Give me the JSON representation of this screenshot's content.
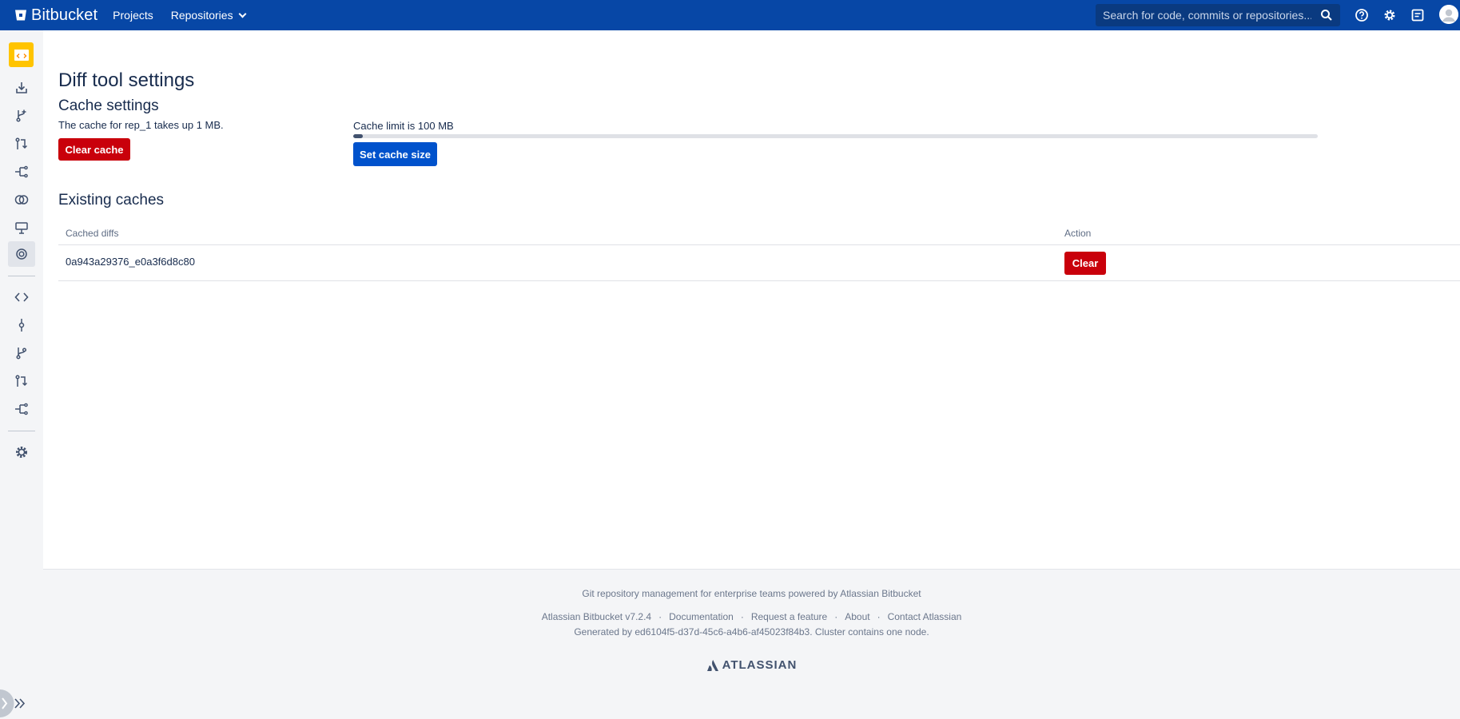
{
  "header": {
    "brand": "Bitbucket",
    "nav": [
      {
        "label": "Projects"
      },
      {
        "label": "Repositories"
      }
    ],
    "search_placeholder": "Search for code, commits or repositories...",
    "icons": [
      "help-icon",
      "gear-icon",
      "inbox-icon",
      "avatar"
    ]
  },
  "sidebar": {
    "items": [
      {
        "icon": "repository-avatar"
      },
      {
        "icon": "clone-icon"
      },
      {
        "icon": "create-branch-icon"
      },
      {
        "icon": "create-pull-request-icon"
      },
      {
        "icon": "fork-icon"
      },
      {
        "icon": "compare-icon"
      },
      {
        "icon": "create-directory-icon"
      },
      {
        "icon": "diff-tool-settings-icon"
      },
      {
        "icon": "source-icon"
      },
      {
        "icon": "commits-icon"
      },
      {
        "icon": "branches-icon"
      },
      {
        "icon": "pull-requests-icon"
      },
      {
        "icon": "forks-icon"
      },
      {
        "icon": "repository-settings-icon"
      },
      {
        "icon": "expand-sidebar-icon"
      }
    ]
  },
  "main": {
    "title": "Diff tool settings",
    "cache_settings": {
      "heading": "Cache settings",
      "description": "The cache for rep_1 takes up 1 MB.",
      "clear_cache_label": "Clear cache",
      "limit_label": "Cache limit is 100 MB",
      "usage_fraction": 0.01,
      "set_size_label": "Set cache size"
    },
    "existing_caches": {
      "heading": "Existing caches",
      "columns": [
        "Cached diffs",
        "Action"
      ],
      "rows": [
        {
          "diff": "0a943a29376_e0a3f6d8c80",
          "action_label": "Clear"
        }
      ]
    }
  },
  "footer": {
    "tagline": "Git repository management for enterprise teams powered by Atlassian Bitbucket",
    "links": [
      "Atlassian Bitbucket v7.2.4",
      "Documentation",
      "Request a feature",
      "About",
      "Contact Atlassian"
    ],
    "separator": "·",
    "generated": "Generated by ed6104f5-d37d-45c6-a4b6-af45023f84b3. Cluster contains one node.",
    "logo_text": "ATLASSIAN"
  },
  "colors": {
    "header_bg": "#0747a6",
    "danger": "#c9000b",
    "primary": "#0052cc",
    "repo_avatar": "#ffc400"
  }
}
